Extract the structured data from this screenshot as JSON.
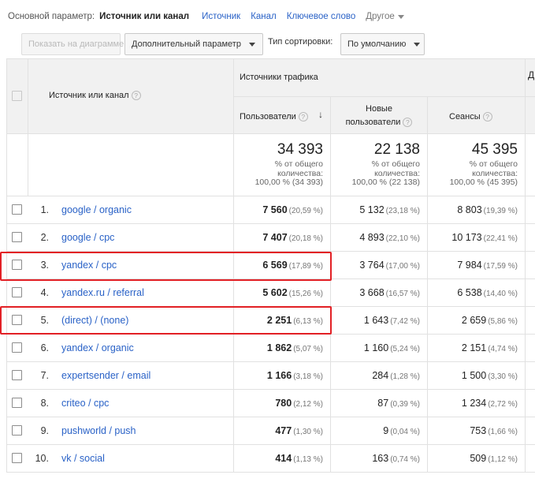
{
  "dimension_bar": {
    "label": "Основной параметр:",
    "active": "Источник или канал",
    "links": [
      "Источник",
      "Канал",
      "Ключевое слово"
    ],
    "other": "Другое"
  },
  "toolbar": {
    "show_on_chart": "Показать на диаграмме",
    "secondary_dimension": "Дополнительный параметр",
    "sort_type_label": "Тип сортировки:",
    "sort_type_value": "По умолчанию"
  },
  "table": {
    "dimension_header": "Источник или канал",
    "group_header": "Источники трафика",
    "columns": [
      "Пользователи",
      "Новые пользователи",
      "Сеансы"
    ],
    "new_users_line1": "Новые",
    "new_users_line2": "пользователи",
    "totals": [
      {
        "value": "34 393",
        "line1": "% от общего",
        "line2": "количества:",
        "line3": "100,00 % (34 393)"
      },
      {
        "value": "22 138",
        "line1": "% от общего",
        "line2": "количества:",
        "line3": "100,00 % (22 138)"
      },
      {
        "value": "45 395",
        "line1": "% от общего",
        "line2": "количества:",
        "line3": "100,00 % (45 395)"
      }
    ],
    "rows": [
      {
        "n": "1.",
        "source": "google / organic",
        "users": "7 560",
        "users_pct": "(20,59 %)",
        "new": "5 132",
        "new_pct": "(23,18 %)",
        "sessions": "8 803",
        "sessions_pct": "(19,39 %)"
      },
      {
        "n": "2.",
        "source": "google / cpc",
        "users": "7 407",
        "users_pct": "(20,18 %)",
        "new": "4 893",
        "new_pct": "(22,10 %)",
        "sessions": "10 173",
        "sessions_pct": "(22,41 %)"
      },
      {
        "n": "3.",
        "source": "yandex / cpc",
        "users": "6 569",
        "users_pct": "(17,89 %)",
        "new": "3 764",
        "new_pct": "(17,00 %)",
        "sessions": "7 984",
        "sessions_pct": "(17,59 %)"
      },
      {
        "n": "4.",
        "source": "yandex.ru / referral",
        "users": "5 602",
        "users_pct": "(15,26 %)",
        "new": "3 668",
        "new_pct": "(16,57 %)",
        "sessions": "6 538",
        "sessions_pct": "(14,40 %)"
      },
      {
        "n": "5.",
        "source": "(direct) / (none)",
        "users": "2 251",
        "users_pct": "(6,13 %)",
        "new": "1 643",
        "new_pct": "(7,42 %)",
        "sessions": "2 659",
        "sessions_pct": "(5,86 %)"
      },
      {
        "n": "6.",
        "source": "yandex / organic",
        "users": "1 862",
        "users_pct": "(5,07 %)",
        "new": "1 160",
        "new_pct": "(5,24 %)",
        "sessions": "2 151",
        "sessions_pct": "(4,74 %)"
      },
      {
        "n": "7.",
        "source": "expertsender / email",
        "users": "1 166",
        "users_pct": "(3,18 %)",
        "new": "284",
        "new_pct": "(1,28 %)",
        "sessions": "1 500",
        "sessions_pct": "(3,30 %)"
      },
      {
        "n": "8.",
        "source": "criteo / cpc",
        "users": "780",
        "users_pct": "(2,12 %)",
        "new": "87",
        "new_pct": "(0,39 %)",
        "sessions": "1 234",
        "sessions_pct": "(2,72 %)"
      },
      {
        "n": "9.",
        "source": "pushworld / push",
        "users": "477",
        "users_pct": "(1,30 %)",
        "new": "9",
        "new_pct": "(0,04 %)",
        "sessions": "753",
        "sessions_pct": "(1,66 %)"
      },
      {
        "n": "10.",
        "source": "vk / social",
        "users": "414",
        "users_pct": "(1,13 %)",
        "new": "163",
        "new_pct": "(0,74 %)",
        "sessions": "509",
        "sessions_pct": "(1,12 %)"
      }
    ],
    "highlighted_rows": [
      2,
      4
    ]
  },
  "colors": {
    "link": "#2a62c7",
    "highlight": "#e22025",
    "header_bg": "#f1f1f1"
  }
}
